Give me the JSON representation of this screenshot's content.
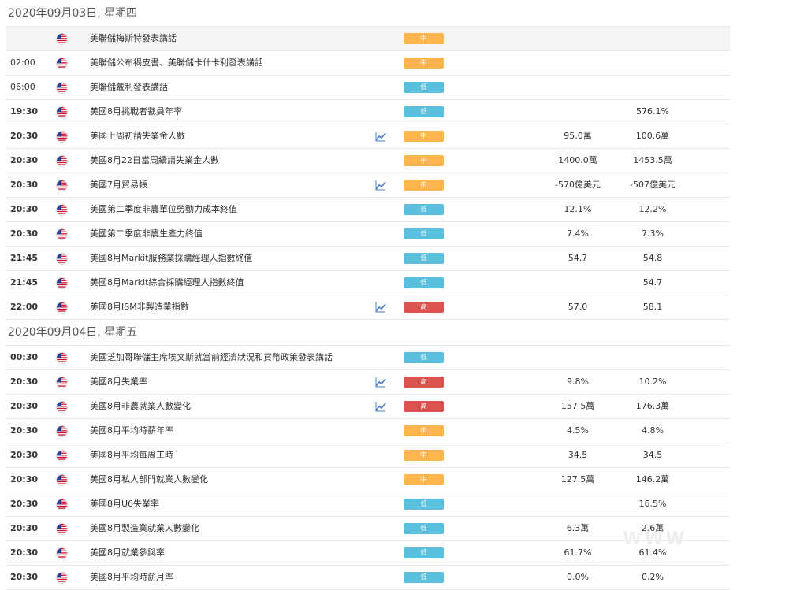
{
  "days": [
    {
      "date_label": "2020年09月03日, 星期四",
      "rows": [
        {
          "time": "",
          "event": "美聯儲梅斯特發表講話",
          "chart": false,
          "importance": "中",
          "level": "mid",
          "forecast": "",
          "previous": "",
          "shade": true
        },
        {
          "time": "02:00",
          "event": "美聯儲公布褐皮書、美聯儲卡什卡利發表講話",
          "chart": false,
          "importance": "中",
          "level": "mid",
          "forecast": "",
          "previous": "",
          "light": true
        },
        {
          "time": "06:00",
          "event": "美聯儲戴利發表講話",
          "chart": false,
          "importance": "低",
          "level": "low",
          "forecast": "",
          "previous": "",
          "light": true
        },
        {
          "time": "19:30",
          "event": "美國8月挑戰者裁員年率",
          "chart": false,
          "importance": "低",
          "level": "low",
          "forecast": "",
          "previous": "576.1%"
        },
        {
          "time": "20:30",
          "event": "美國上周初請失業金人數",
          "chart": true,
          "importance": "中",
          "level": "mid",
          "forecast": "95.0萬",
          "previous": "100.6萬"
        },
        {
          "time": "20:30",
          "event": "美國8月22日當周續請失業金人數",
          "chart": false,
          "importance": "中",
          "level": "mid",
          "forecast": "1400.0萬",
          "previous": "1453.5萬"
        },
        {
          "time": "20:30",
          "event": "美國7月貿易帳",
          "chart": true,
          "importance": "中",
          "level": "mid",
          "forecast": "-570億美元",
          "previous": "-507億美元"
        },
        {
          "time": "20:30",
          "event": "美國第二季度非農單位勞動力成本終值",
          "chart": false,
          "importance": "低",
          "level": "low",
          "forecast": "12.1%",
          "previous": "12.2%"
        },
        {
          "time": "20:30",
          "event": "美國第二季度非農生產力終值",
          "chart": false,
          "importance": "低",
          "level": "low",
          "forecast": "7.4%",
          "previous": "7.3%"
        },
        {
          "time": "21:45",
          "event": "美國8月Markit服務業採購經理人指數終值",
          "chart": false,
          "importance": "低",
          "level": "low",
          "forecast": "54.7",
          "previous": "54.8"
        },
        {
          "time": "21:45",
          "event": "美國8月Markit綜合採購經理人指數終值",
          "chart": false,
          "importance": "低",
          "level": "low",
          "forecast": "",
          "previous": "54.7"
        },
        {
          "time": "22:00",
          "event": "美國8月ISM非製造業指數",
          "chart": true,
          "importance": "高",
          "level": "high",
          "forecast": "57.0",
          "previous": "58.1"
        }
      ]
    },
    {
      "date_label": "2020年09月04日, 星期五",
      "rows": [
        {
          "time": "00:30",
          "event": "美國芝加哥聯儲主席埃文斯就當前經濟狀況和貨幣政策發表講話",
          "chart": false,
          "importance": "低",
          "level": "low",
          "forecast": "",
          "previous": ""
        },
        {
          "time": "20:30",
          "event": "美國8月失業率",
          "chart": true,
          "importance": "高",
          "level": "high",
          "forecast": "9.8%",
          "previous": "10.2%"
        },
        {
          "time": "20:30",
          "event": "美國8月非農就業人數變化",
          "chart": true,
          "importance": "高",
          "level": "high",
          "forecast": "157.5萬",
          "previous": "176.3萬"
        },
        {
          "time": "20:30",
          "event": "美國8月平均時薪年率",
          "chart": false,
          "importance": "中",
          "level": "mid",
          "forecast": "4.5%",
          "previous": "4.8%"
        },
        {
          "time": "20:30",
          "event": "美國8月平均每周工時",
          "chart": false,
          "importance": "中",
          "level": "mid",
          "forecast": "34.5",
          "previous": "34.5"
        },
        {
          "time": "20:30",
          "event": "美國8月私人部門就業人數變化",
          "chart": false,
          "importance": "中",
          "level": "mid",
          "forecast": "127.5萬",
          "previous": "146.2萬"
        },
        {
          "time": "20:30",
          "event": "美國8月U6失業率",
          "chart": false,
          "importance": "低",
          "level": "low",
          "forecast": "",
          "previous": "16.5%"
        },
        {
          "time": "20:30",
          "event": "美國8月製造業就業人數變化",
          "chart": false,
          "importance": "低",
          "level": "low",
          "forecast": "6.3萬",
          "previous": "2.6萬"
        },
        {
          "time": "20:30",
          "event": "美國8月就業參與率",
          "chart": false,
          "importance": "低",
          "level": "low",
          "forecast": "61.7%",
          "previous": "61.4%"
        },
        {
          "time": "20:30",
          "event": "美國8月平均時薪月率",
          "chart": false,
          "importance": "低",
          "level": "low",
          "forecast": "0.0%",
          "previous": "0.2%"
        }
      ]
    }
  ],
  "icons": {
    "flag": "us-flag-icon",
    "chart": "chart-line-icon"
  },
  "colors": {
    "mid": "#fdb64e",
    "low": "#5bc0de",
    "high": "#d9534f",
    "chart_icon": "#4a7fc1"
  }
}
